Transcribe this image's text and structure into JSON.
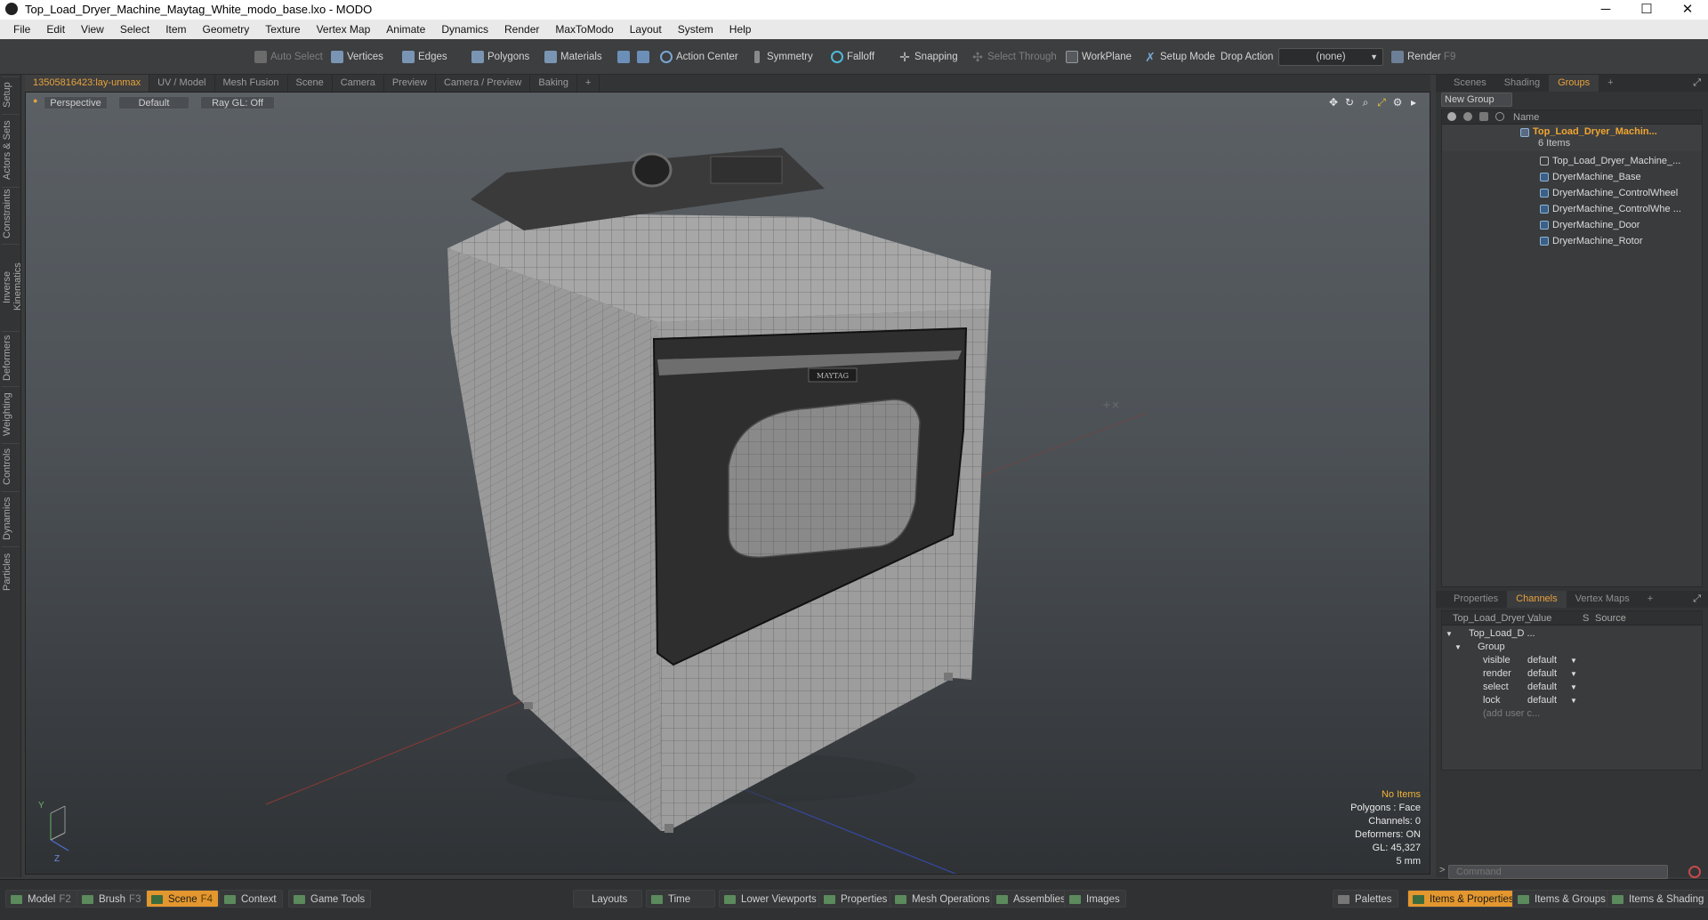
{
  "window": {
    "title": "Top_Load_Dryer_Machine_Maytag_White_modo_base.lxo - MODO",
    "controls": [
      "─",
      "☐",
      "✕"
    ]
  },
  "menu": [
    "File",
    "Edit",
    "View",
    "Select",
    "Item",
    "Geometry",
    "Texture",
    "Vertex Map",
    "Animate",
    "Dynamics",
    "Render",
    "MaxToModo",
    "Layout",
    "System",
    "Help"
  ],
  "toolbar": {
    "auto_select": "Auto Select",
    "vertices": "Vertices",
    "edges": "Edges",
    "polygons": "Polygons",
    "materials": "Materials",
    "action_center": "Action Center",
    "symmetry": "Symmetry",
    "falloff": "Falloff",
    "snapping": "Snapping",
    "select_through": "Select Through",
    "workplane": "WorkPlane",
    "setup_mode": "Setup Mode",
    "drop_action": "Drop Action",
    "drop_value": "(none)",
    "render": "Render",
    "render_key": "F9"
  },
  "sidetabs": [
    "Setup",
    "Actors & Sets",
    "Constraints",
    "Inverse Kinematics",
    "Deformers",
    "Weighting",
    "Controls",
    "Dynamics",
    "Particles"
  ],
  "viewport_tabs": [
    "13505816423:lay-unmax",
    "UV / Model",
    "Mesh Fusion",
    "Scene",
    "Camera",
    "Preview",
    "Camera / Preview",
    "Baking",
    "+"
  ],
  "viewport": {
    "view": "Perspective",
    "shading": "Default",
    "raygl": "Ray GL: Off",
    "brand": "MAYTAG",
    "axis_y": "Y",
    "axis_z": "Z",
    "stats": {
      "items": "No Items",
      "polygons": "Polygons : Face",
      "channels": "Channels: 0",
      "deformers": "Deformers: ON",
      "gl": "GL: 45,327",
      "unit": "5 mm"
    }
  },
  "groups": {
    "tabs": [
      "Scenes",
      "Shading",
      "Groups",
      "+"
    ],
    "new_group": "New Group",
    "col_name": "Name",
    "root": "Top_Load_Dryer_Machin...",
    "root_count": "6 Items",
    "items": [
      "Top_Load_Dryer_Machine_...",
      "DryerMachine_Base",
      "DryerMachine_ControlWheel",
      "DryerMachine_ControlWhe ...",
      "DryerMachine_Door",
      "DryerMachine_Rotor"
    ]
  },
  "channels": {
    "tabs": [
      "Properties",
      "Channels",
      "Vertex Maps",
      "+"
    ],
    "headers": {
      "name": "Top_Load_Dryer_...",
      "value": "Value",
      "s": "S",
      "source": "Source"
    },
    "root": "Top_Load_D ...",
    "group": "Group",
    "rows": [
      {
        "name": "visible",
        "value": "default"
      },
      {
        "name": "render",
        "value": "default"
      },
      {
        "name": "select",
        "value": "default"
      },
      {
        "name": "lock",
        "value": "default"
      }
    ],
    "add": "(add user c..."
  },
  "command": {
    "placeholder": "Command",
    "prompt": ">"
  },
  "statusbar": {
    "model": "Model",
    "model_key": "F2",
    "brush": "Brush",
    "brush_key": "F3",
    "scene": "Scene",
    "scene_key": "F4",
    "context": "Context",
    "game": "Game Tools",
    "layouts": "Layouts",
    "time": "Time",
    "lower": "Lower Viewports",
    "properties": "Properties",
    "meshops": "Mesh Operations",
    "assemblies": "Assemblies",
    "images": "Images",
    "palettes": "Palettes",
    "items_props": "Items & Properties",
    "items_groups": "Items & Groups",
    "items_shading": "Items & Shading"
  }
}
